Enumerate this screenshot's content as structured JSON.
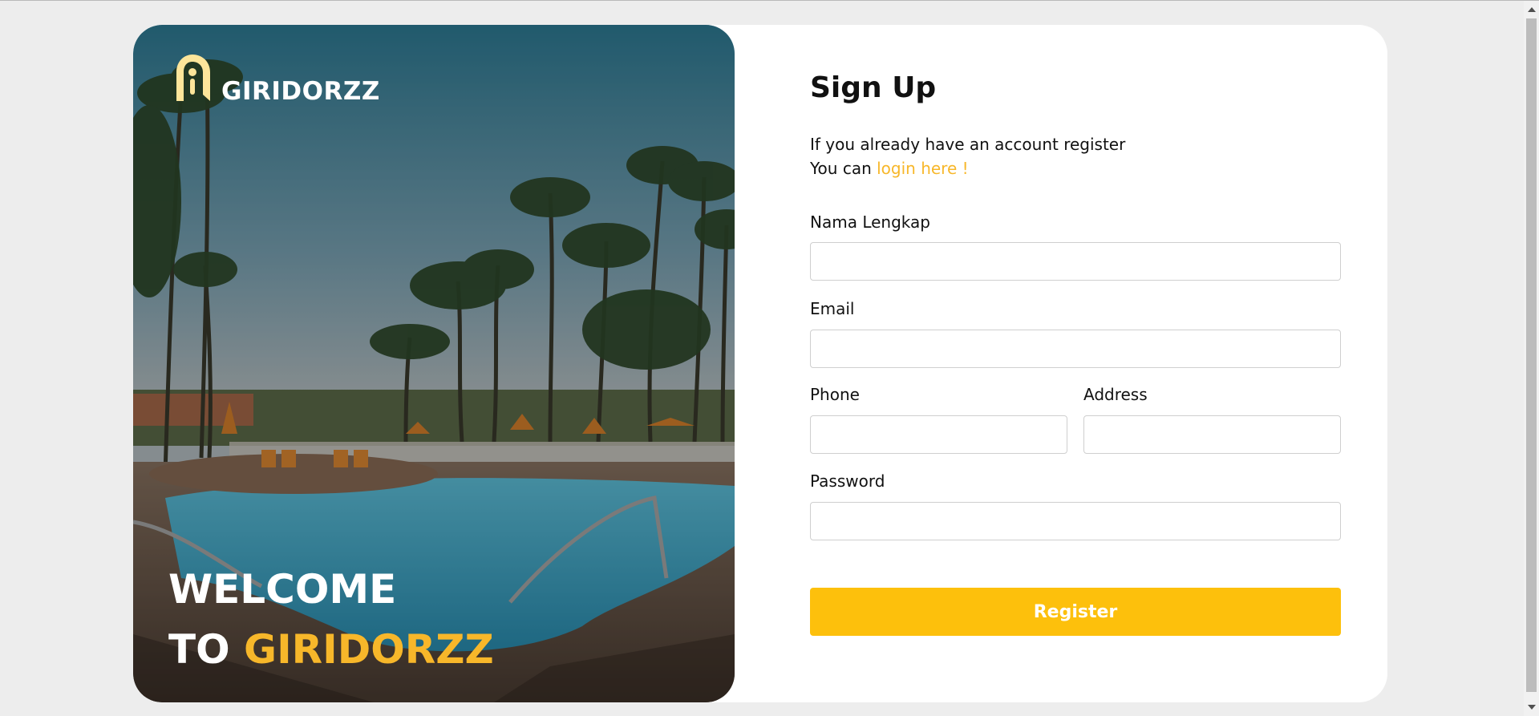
{
  "brand": {
    "logo_text": "GIRIDORZZ",
    "accent_color": "#f7b72a",
    "button_color": "#fdc00c"
  },
  "hero": {
    "welcome_line1": "WELCOME",
    "welcome_line2_prefix": "TO ",
    "welcome_line2_accent": "GIRIDORZZ"
  },
  "form": {
    "title": "Sign Up",
    "subtitle_line1": "If you already have an account register",
    "subtitle_line2_prefix": "You can ",
    "login_link": "login here !",
    "fields": {
      "full_name": {
        "label": "Nama Lengkap",
        "value": "",
        "placeholder": ""
      },
      "email": {
        "label": "Email",
        "value": "",
        "placeholder": ""
      },
      "phone": {
        "label": "Phone",
        "value": "",
        "placeholder": ""
      },
      "address": {
        "label": "Address",
        "value": "",
        "placeholder": ""
      },
      "password": {
        "label": "Password",
        "value": "",
        "placeholder": ""
      }
    },
    "register_label": "Register"
  }
}
